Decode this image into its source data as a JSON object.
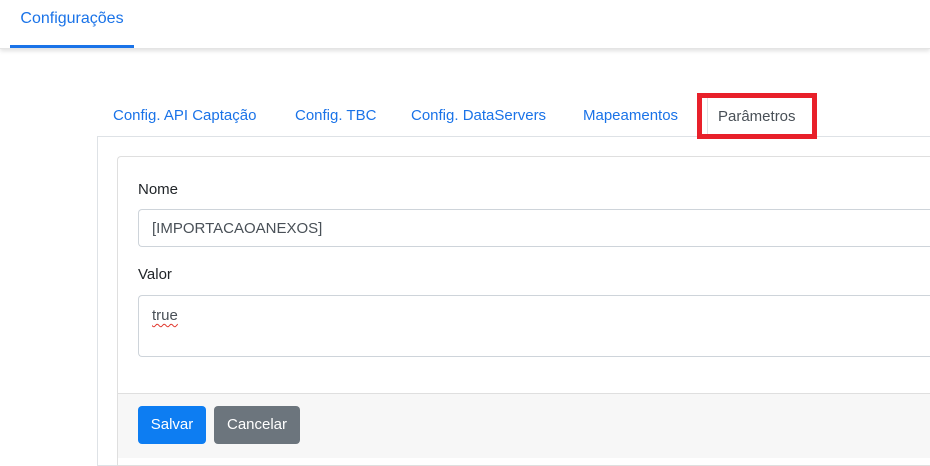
{
  "header": {
    "tab_label": "Configurações",
    "accent_color": "#1a73e8"
  },
  "tabs": [
    {
      "label": "Config. API Captação"
    },
    {
      "label": "Config. TBC"
    },
    {
      "label": "Config. DataServers"
    },
    {
      "label": "Mapeamentos"
    },
    {
      "label": "Parâmetros",
      "active": true
    }
  ],
  "highlight_color": "#e8202a",
  "form": {
    "nome_label": "Nome",
    "nome_value": "[IMPORTACAOANEXOS]",
    "valor_label": "Valor",
    "valor_value": "true"
  },
  "buttons": {
    "save_label": "Salvar",
    "cancel_label": "Cancelar",
    "primary_color": "#0d7df2",
    "secondary_color": "#6c757d"
  }
}
